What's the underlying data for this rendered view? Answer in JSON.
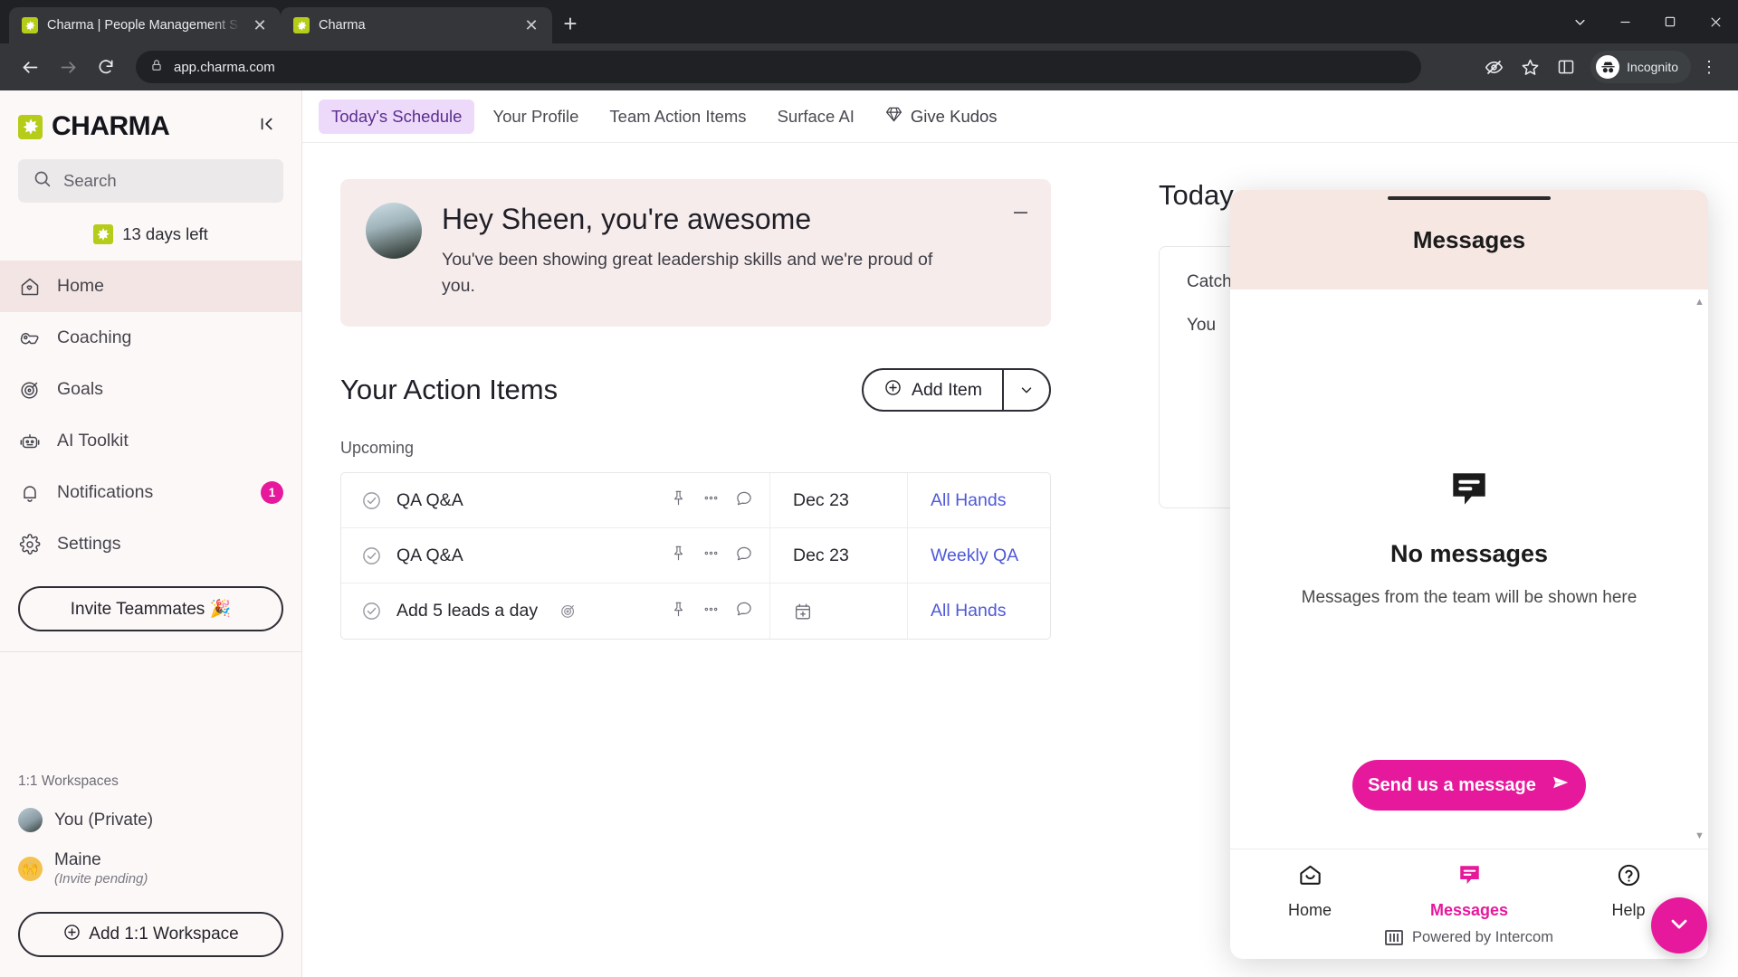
{
  "browser": {
    "tabs": [
      {
        "title": "Charma | People Management S",
        "favicon": "charma-star-icon",
        "active": false
      },
      {
        "title": "Charma",
        "favicon": "charma-star-icon",
        "active": true
      }
    ],
    "new_tab_label": "+",
    "window_controls": {
      "expand": "⌄",
      "minimize": "–",
      "maximize": "☐",
      "close": "✕"
    },
    "url": "app.charma.com",
    "profile_label": "Incognito"
  },
  "sidebar": {
    "brand": "CHARMA",
    "collapse_label": "⇤",
    "search_placeholder": "Search",
    "trial_text": "13 days left",
    "nav": [
      {
        "label": "Home",
        "icon": "home-icon",
        "active": true,
        "badge": ""
      },
      {
        "label": "Coaching",
        "icon": "whistle-icon",
        "active": false,
        "badge": ""
      },
      {
        "label": "Goals",
        "icon": "target-icon",
        "active": false,
        "badge": ""
      },
      {
        "label": "AI Toolkit",
        "icon": "robot-icon",
        "active": false,
        "badge": ""
      },
      {
        "label": "Notifications",
        "icon": "bell-icon",
        "active": false,
        "badge": "1"
      },
      {
        "label": "Settings",
        "icon": "gear-icon",
        "active": false,
        "badge": ""
      }
    ],
    "invite_label": "Invite Teammates 🎉",
    "workspaces_label": "1:1 Workspaces",
    "workspaces": [
      {
        "name": "You (Private)",
        "sub": "",
        "avatar": "photo-avatar"
      },
      {
        "name": "Maine",
        "sub": "(Invite pending)",
        "avatar": "🙌"
      }
    ],
    "add_workspace_label": "Add 1:1 Workspace"
  },
  "main": {
    "tabs": [
      {
        "label": "Today's Schedule",
        "active": true,
        "icon": ""
      },
      {
        "label": "Your Profile",
        "active": false,
        "icon": ""
      },
      {
        "label": "Team Action Items",
        "active": false,
        "icon": ""
      },
      {
        "label": "Surface AI",
        "active": false,
        "icon": ""
      },
      {
        "label": "Give Kudos",
        "active": false,
        "icon": "gem-icon"
      }
    ],
    "kudos": {
      "title": "Hey Sheen, you're awesome",
      "body": "You've been showing great leadership skills and we're proud of you.",
      "minimize_label": "–"
    },
    "action_items": {
      "heading": "Your Action Items",
      "add_label": "Add Item",
      "caret": "⌄",
      "section_label": "Upcoming",
      "rows": [
        {
          "text": "QA Q&A",
          "has_goal": false,
          "date": "Dec 23",
          "meeting": "All Hands"
        },
        {
          "text": "QA Q&A",
          "has_goal": false,
          "date": "Dec 23",
          "meeting": "Weekly QA"
        },
        {
          "text": "Add 5 leads a day",
          "has_goal": true,
          "date": "",
          "meeting": "All Hands"
        }
      ]
    },
    "today": {
      "title": "Today",
      "line1": "Catch up",
      "line2": "You"
    }
  },
  "intercom": {
    "title": "Messages",
    "empty_title": "No messages",
    "empty_sub": "Messages from the team will be shown here",
    "send_label": "Send us a message",
    "footer_nav": [
      {
        "label": "Home",
        "icon": "home-icon",
        "active": false
      },
      {
        "label": "Messages",
        "icon": "message-icon",
        "active": true
      },
      {
        "label": "Help",
        "icon": "question-icon",
        "active": false
      }
    ],
    "powered_by": "Powered by Intercom",
    "fab_icon": "chevron-down-icon"
  },
  "colors": {
    "brand_green": "#b5cc18",
    "accent_pink": "#e6199c",
    "tab_active_bg": "#eddafb",
    "tab_active_text": "#5b2d8e",
    "link_blue": "#4f59d8",
    "sidebar_bg": "#fdf8f8",
    "kudos_bg": "#f7ecec"
  }
}
